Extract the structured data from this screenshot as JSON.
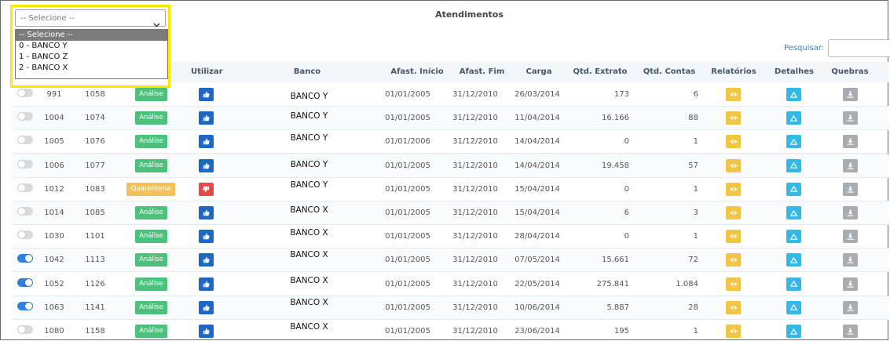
{
  "title": "Atendimentos",
  "search": {
    "label": "Pesquisar:",
    "value": ""
  },
  "dropdown": {
    "selected": "-- Selecione --",
    "options": [
      "-- Selecione --",
      "0 - BANCO Y",
      "1 - BANCO Z",
      "2 - BANCO X"
    ]
  },
  "columns": {
    "utilizar": "Utilizar",
    "banco": "Banco",
    "afast_inicio": "Afast. Início",
    "afast_fim": "Afast. Fim",
    "carga": "Carga",
    "qtd_extrato": "Qtd. Extrato",
    "qtd_contas": "Qtd. Contas",
    "relatorios": "Relatórios",
    "detalhes": "Detalhes",
    "quebras": "Quebras"
  },
  "colors": {
    "analise": "#4cc17c",
    "quarentena": "#f2c25a",
    "like": "#1c68c3",
    "dislike": "#e54a4a",
    "relatorios": "#f2c645",
    "detalhes": "#33b8ea",
    "quebras": "#a9adb2"
  },
  "rows": [
    {
      "toggle_on": false,
      "id": "991",
      "code": "1058",
      "status": "Análise",
      "status_type": "ok",
      "use_icon": "thumbs-up-icon",
      "bank": "BANCO Y",
      "inicio": "01/01/2005",
      "fim": "31/12/2010",
      "carga": "26/03/2014",
      "extrato": "173",
      "contas": "6"
    },
    {
      "toggle_on": false,
      "id": "1004",
      "code": "1074",
      "status": "Análise",
      "status_type": "ok",
      "use_icon": "thumbs-up-icon",
      "bank": "BANCO Y",
      "inicio": "01/01/2005",
      "fim": "31/12/2010",
      "carga": "11/04/2014",
      "extrato": "16.166",
      "contas": "88"
    },
    {
      "toggle_on": false,
      "id": "1005",
      "code": "1076",
      "status": "Análise",
      "status_type": "ok",
      "use_icon": "thumbs-up-icon",
      "bank": "BANCO Y",
      "inicio": "01/01/2006",
      "fim": "31/12/2010",
      "carga": "14/04/2014",
      "extrato": "0",
      "contas": "1"
    },
    {
      "toggle_on": false,
      "id": "1006",
      "code": "1077",
      "status": "Análise",
      "status_type": "ok",
      "use_icon": "thumbs-up-icon",
      "bank": "BANCO Y",
      "inicio": "01/01/2005",
      "fim": "31/12/2010",
      "carga": "14/04/2014",
      "extrato": "19.458",
      "contas": "57"
    },
    {
      "toggle_on": false,
      "id": "1012",
      "code": "1083",
      "status": "Quarentena",
      "status_type": "warn",
      "use_icon": "thumbs-down-icon",
      "bank": "BANCO Y",
      "inicio": "01/01/2005",
      "fim": "31/12/2010",
      "carga": "15/04/2014",
      "extrato": "0",
      "contas": "1"
    },
    {
      "toggle_on": false,
      "id": "1014",
      "code": "1085",
      "status": "Análise",
      "status_type": "ok",
      "use_icon": "thumbs-up-icon",
      "bank": "BANCO X",
      "inicio": "01/01/2005",
      "fim": "31/12/2010",
      "carga": "15/04/2014",
      "extrato": "6",
      "contas": "3"
    },
    {
      "toggle_on": false,
      "id": "1030",
      "code": "1101",
      "status": "Análise",
      "status_type": "ok",
      "use_icon": "thumbs-up-icon",
      "bank": "BANCO X",
      "inicio": "01/01/2005",
      "fim": "31/12/2010",
      "carga": "28/04/2014",
      "extrato": "0",
      "contas": "1"
    },
    {
      "toggle_on": true,
      "id": "1042",
      "code": "1113",
      "status": "Análise",
      "status_type": "ok",
      "use_icon": "thumbs-up-icon",
      "bank": "BANCO X",
      "inicio": "01/01/2005",
      "fim": "31/12/2010",
      "carga": "07/05/2014",
      "extrato": "15.661",
      "contas": "72"
    },
    {
      "toggle_on": true,
      "id": "1052",
      "code": "1126",
      "status": "Análise",
      "status_type": "ok",
      "use_icon": "thumbs-up-icon",
      "bank": "BANCO X",
      "inicio": "01/01/2005",
      "fim": "31/12/2010",
      "carga": "22/05/2014",
      "extrato": "275.841",
      "contas": "1.084"
    },
    {
      "toggle_on": true,
      "id": "1063",
      "code": "1141",
      "status": "Análise",
      "status_type": "ok",
      "use_icon": "thumbs-up-icon",
      "bank": "BANCO X",
      "inicio": "01/01/2005",
      "fim": "31/12/2010",
      "carga": "10/06/2014",
      "extrato": "5.887",
      "contas": "28"
    },
    {
      "toggle_on": false,
      "id": "1080",
      "code": "1158",
      "status": "Análise",
      "status_type": "ok",
      "use_icon": "thumbs-up-icon",
      "bank": "BANCO X",
      "inicio": "01/01/2005",
      "fim": "31/12/2010",
      "carga": "23/06/2014",
      "extrato": "195",
      "contas": "1"
    }
  ]
}
